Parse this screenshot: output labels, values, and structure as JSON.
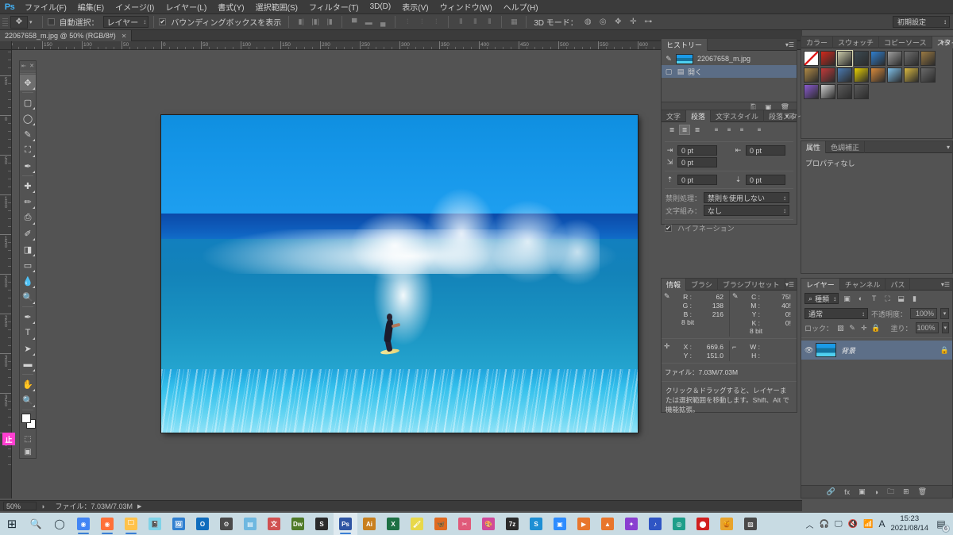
{
  "app": {
    "logo": "Ps",
    "workspace": "initial_setting"
  },
  "menubar": {
    "items": [
      "ファイル(F)",
      "編集(E)",
      "イメージ(I)",
      "レイヤー(L)",
      "書式(Y)",
      "選択範囲(S)",
      "フィルター(T)",
      "3D(D)",
      "表示(V)",
      "ウィンドウ(W)",
      "ヘルプ(H)"
    ]
  },
  "options": {
    "tool_icon": "move-tool",
    "auto_select_label": "自動選択：",
    "auto_select_value": "レイヤー",
    "bounding_box_label": "バウンディングボックスを表示",
    "bounding_box_checked": "✔",
    "mode3d_label": "3D モード：",
    "workspace_switcher": "初期設定"
  },
  "document": {
    "tab_title": "22067658_m.jpg @ 50% (RGB/8#)",
    "close": "✕"
  },
  "rulers": {
    "horizontal": [
      "200",
      "150",
      "100",
      "50",
      "0",
      "50",
      "100",
      "150",
      "200",
      "250",
      "300",
      "350",
      "400",
      "450",
      "500",
      "550",
      "600",
      "650",
      "700"
    ],
    "vertical": [
      "100",
      "50",
      "0",
      "50",
      "100",
      "150",
      "200",
      "250",
      "300",
      "350",
      "400"
    ]
  },
  "toolbar": {
    "tools": [
      {
        "name": "move-tool",
        "glyph": "✥",
        "active": true
      },
      {
        "name": "rectangular-marquee-tool",
        "glyph": "▢"
      },
      {
        "name": "lasso-tool",
        "glyph": "◯"
      },
      {
        "name": "quick-selection-tool",
        "glyph": "✎"
      },
      {
        "name": "crop-tool",
        "glyph": "⛶"
      },
      {
        "name": "eyedropper-tool",
        "glyph": "✒"
      },
      {
        "name": "spot-healing-brush-tool",
        "glyph": "✚"
      },
      {
        "name": "brush-tool",
        "glyph": "✏"
      },
      {
        "name": "clone-stamp-tool",
        "glyph": "⎙"
      },
      {
        "name": "history-brush-tool",
        "glyph": "✐"
      },
      {
        "name": "eraser-tool",
        "glyph": "◨"
      },
      {
        "name": "gradient-tool",
        "glyph": "▭"
      },
      {
        "name": "blur-tool",
        "glyph": "💧"
      },
      {
        "name": "dodge-tool",
        "glyph": "🔍"
      },
      {
        "name": "pen-tool",
        "glyph": "✒"
      },
      {
        "name": "horizontal-type-tool",
        "glyph": "T"
      },
      {
        "name": "path-selection-tool",
        "glyph": "➤"
      },
      {
        "name": "rectangle-tool",
        "glyph": "▬"
      },
      {
        "name": "hand-tool",
        "glyph": "✋"
      },
      {
        "name": "zoom-tool",
        "glyph": "🔍"
      }
    ],
    "quick_mask": "⬚",
    "screen_mode": "▣"
  },
  "panels": {
    "history": {
      "tabs": [
        {
          "label": "ヒストリー",
          "active": true
        }
      ],
      "entries": [
        {
          "label": "22067658_m.jpg",
          "type": "snapshot"
        },
        {
          "label": "開く",
          "type": "state",
          "selected": true
        }
      ],
      "footer_icons": [
        "new-document-icon",
        "new-snapshot-icon",
        "delete-icon"
      ]
    },
    "paragraph": {
      "tabs": [
        {
          "label": "文字",
          "active": false
        },
        {
          "label": "段落",
          "active": true
        },
        {
          "label": "文字スタイル",
          "active": false
        },
        {
          "label": "段落スタイル",
          "active": false
        }
      ],
      "align_buttons": [
        "align-left",
        "align-center",
        "align-right",
        "justify-last-left",
        "justify-last-center",
        "justify-last-right",
        "justify-all"
      ],
      "active_align_index": 1,
      "indent_left": "0 pt",
      "indent_right": "0 pt",
      "indent_first_line": "0 pt",
      "space_before": "0 pt",
      "space_after": "0 pt",
      "kinsoku_label": "禁則処理：",
      "kinsoku_value": "禁則を使用しない",
      "mojikumi_label": "文字組み：",
      "mojikumi_value": "なし",
      "hyphenation_label": "ハイフネーション",
      "hyphenation_checked": "✔"
    },
    "info": {
      "tabs": [
        {
          "label": "情報",
          "active": true
        },
        {
          "label": "ブラシ",
          "active": false
        },
        {
          "label": "ブラシプリセット",
          "active": false
        }
      ],
      "rgb": {
        "R": "62",
        "G": "138",
        "B": "216",
        "depth": "8 bit"
      },
      "cmyk": {
        "C": "75!",
        "M": "40!",
        "Y": "0!",
        "K": "0!",
        "depth": "8 bit"
      },
      "pointer": {
        "X": "669.6",
        "Y": "151.0"
      },
      "selection": {
        "W": "",
        "H": ""
      },
      "file_label": "ファイル：7.03M/7.03M",
      "hint": "クリック＆ドラッグすると、レイヤーまたは選択範囲を移動します。Shift、Alt で機能拡張。"
    },
    "styles": {
      "tabs": [
        {
          "label": "カラー",
          "active": false
        },
        {
          "label": "スウォッチ",
          "active": false
        },
        {
          "label": "コピーソース",
          "active": false
        },
        {
          "label": "スタイル",
          "active": true
        }
      ],
      "swatch_colors": [
        "#ffffff",
        "#d3271a",
        "#c9c9a8",
        "#3c4a52",
        "#2f7fd0",
        "#9e9e9e",
        "#6e6e6e",
        "#9b7a42",
        "#b08a45",
        "#c33a3a",
        "#4a7ab0",
        "#e8d000",
        "#d98a3a",
        "#7fbfe8",
        "#d8b840",
        "#6a6a6a",
        "#8a5ad0",
        "#cfcfcf",
        "#5a5a5a",
        "#5a5a5a"
      ],
      "selected_index": 2
    },
    "attributes": {
      "tabs": [
        {
          "label": "属性",
          "active": true
        },
        {
          "label": "色調補正",
          "active": false
        }
      ],
      "empty_text": "プロパティなし"
    },
    "layers": {
      "tabs": [
        {
          "label": "レイヤー",
          "active": true
        },
        {
          "label": "チャンネル",
          "active": false
        },
        {
          "label": "パス",
          "active": false
        }
      ],
      "filter_label": "種類",
      "filter_icons": [
        "pixel-filter-icon",
        "adjustment-filter-icon",
        "type-filter-icon",
        "shape-filter-icon",
        "smart-object-filter-icon",
        "filter-toggle-icon"
      ],
      "blend_mode": "通常",
      "opacity_label": "不透明度：",
      "opacity_value": "100%",
      "lock_label": "ロック：",
      "lock_icons": [
        "lock-transparent-icon",
        "lock-image-icon",
        "lock-position-icon",
        "lock-all-icon"
      ],
      "fill_label": "塗り：",
      "fill_value": "100%",
      "items": [
        {
          "name": "背景",
          "visible": "👁",
          "locked": "🔒"
        }
      ],
      "footer_icons": [
        "link-icon",
        "fx-icon",
        "mask-icon",
        "adjustment-icon",
        "group-icon",
        "new-layer-icon",
        "delete-layer-icon"
      ]
    }
  },
  "status_bar": {
    "zoom": "50%",
    "doc_icon": "doc-size-icon",
    "file_info": "ファイル：7.03M/7.03M",
    "arrow": "▶"
  },
  "taskbar": {
    "start": "⊞",
    "search": "🔍",
    "cortana": "◯",
    "apps": [
      {
        "name": "chrome",
        "glyph": "◉",
        "color": "#4285f4",
        "running": true
      },
      {
        "name": "firefox",
        "glyph": "◉",
        "color": "#ff7139",
        "running": true
      },
      {
        "name": "file-explorer",
        "glyph": "🗀",
        "color": "#ffc24a",
        "running": true
      },
      {
        "name": "notes",
        "glyph": "📓",
        "color": "#7fd3e8",
        "running": false
      },
      {
        "name": "photos",
        "glyph": "🖼",
        "color": "#2f7fd0",
        "running": false
      },
      {
        "name": "outlook",
        "glyph": "O",
        "color": "#0f6cbd",
        "running": false
      },
      {
        "name": "settings",
        "glyph": "⚙",
        "color": "#4a4a4a",
        "running": false
      },
      {
        "name": "contacts",
        "glyph": "▤",
        "color": "#6fb8e0",
        "running": false
      },
      {
        "name": "translate",
        "glyph": "文",
        "color": "#d05050",
        "running": false
      },
      {
        "name": "dreamweaver",
        "glyph": "Dw",
        "color": "#4f7a28",
        "running": false
      },
      {
        "name": "sublime",
        "glyph": "S",
        "color": "#2b2b2b",
        "running": false
      },
      {
        "name": "photoshop",
        "glyph": "Ps",
        "color": "#2f55a4",
        "running": true,
        "active": true
      },
      {
        "name": "illustrator",
        "glyph": "Ai",
        "color": "#c8801f",
        "running": false
      },
      {
        "name": "excel",
        "glyph": "X",
        "color": "#1d7044",
        "running": false
      },
      {
        "name": "paint",
        "glyph": "🖌",
        "color": "#e8d84a",
        "running": false
      },
      {
        "name": "butterfly-app",
        "glyph": "🦋",
        "color": "#e06a20",
        "running": false
      },
      {
        "name": "scissors-app",
        "glyph": "✂",
        "color": "#e05a7a",
        "running": false
      },
      {
        "name": "palette-app",
        "glyph": "🎨",
        "color": "#d04a9a",
        "running": false
      },
      {
        "name": "7zip",
        "glyph": "7z",
        "color": "#2b2b2b",
        "running": false
      },
      {
        "name": "skype",
        "glyph": "S",
        "color": "#1e8fd4",
        "running": false
      },
      {
        "name": "zoom",
        "glyph": "▣",
        "color": "#2d8cff",
        "running": false
      },
      {
        "name": "media-player",
        "glyph": "▶",
        "color": "#e8762c",
        "running": false
      },
      {
        "name": "vlc",
        "glyph": "▲",
        "color": "#e8762c",
        "running": false
      },
      {
        "name": "inkscape",
        "glyph": "✦",
        "color": "#8a3fd0",
        "running": false
      },
      {
        "name": "music-player",
        "glyph": "♪",
        "color": "#2f55c4",
        "running": false
      },
      {
        "name": "audio-editor",
        "glyph": "◎",
        "color": "#1e9e8a",
        "running": false
      },
      {
        "name": "recorder",
        "glyph": "⬤",
        "color": "#d02020",
        "running": false
      },
      {
        "name": "honey",
        "glyph": "🍯",
        "color": "#e8a42c",
        "running": false
      },
      {
        "name": "notepad",
        "glyph": "▨",
        "color": "#4a4a4a",
        "running": false
      }
    ],
    "tray": {
      "chevron": "︿",
      "icons": [
        "headset-icon",
        "display-icon",
        "volume-mute-icon",
        "wifi-icon",
        "ime-icon"
      ],
      "ime": "A",
      "time": "15:23",
      "date": "2021/08/14",
      "notification_icon": "notification-icon",
      "notification_count": "6"
    }
  }
}
